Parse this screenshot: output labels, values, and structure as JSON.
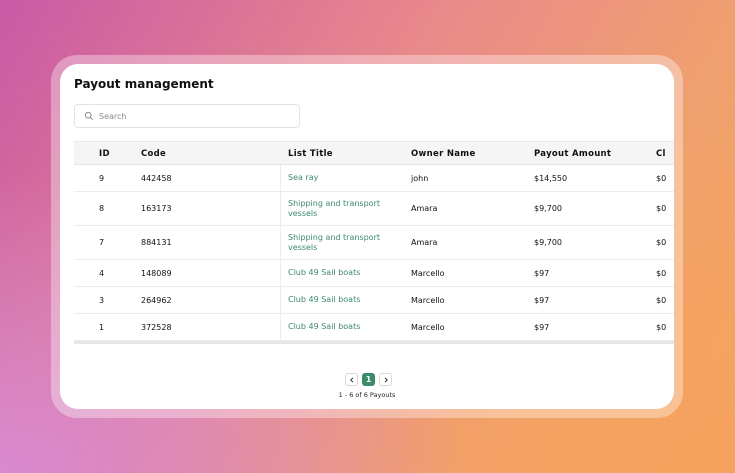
{
  "page": {
    "title": "Payout management"
  },
  "search": {
    "placeholder": "Search",
    "value": ""
  },
  "table": {
    "columns": [
      "ID",
      "Code",
      "List Title",
      "Owner Name",
      "Payout Amount",
      "Cl"
    ],
    "rows": [
      {
        "id": "9",
        "code": "442458",
        "title": "Sea ray",
        "owner": "john",
        "amount": "$14,550",
        "extra": "$0"
      },
      {
        "id": "8",
        "code": "163173",
        "title": "Shipping and transport vessels",
        "owner": "Amara",
        "amount": "$9,700",
        "extra": "$0"
      },
      {
        "id": "7",
        "code": "884131",
        "title": "Shipping and transport vessels",
        "owner": "Amara",
        "amount": "$9,700",
        "extra": "$0"
      },
      {
        "id": "4",
        "code": "148089",
        "title": "Club 49 Sail boats",
        "owner": "Marcello",
        "amount": "$97",
        "extra": "$0"
      },
      {
        "id": "3",
        "code": "264962",
        "title": "Club 49 Sail boats",
        "owner": "Marcello",
        "amount": "$97",
        "extra": "$0"
      },
      {
        "id": "1",
        "code": "372528",
        "title": "Club 49 Sail boats",
        "owner": "Marcello",
        "amount": "$97",
        "extra": "$0"
      }
    ]
  },
  "pagination": {
    "prev_icon": "chevron-left-icon",
    "next_icon": "chevron-right-icon",
    "current_page": "1",
    "summary": "1 - 6 of 6 Payouts"
  },
  "colors": {
    "accent": "#3d8a6a",
    "header_bg": "#f5f5f5"
  }
}
